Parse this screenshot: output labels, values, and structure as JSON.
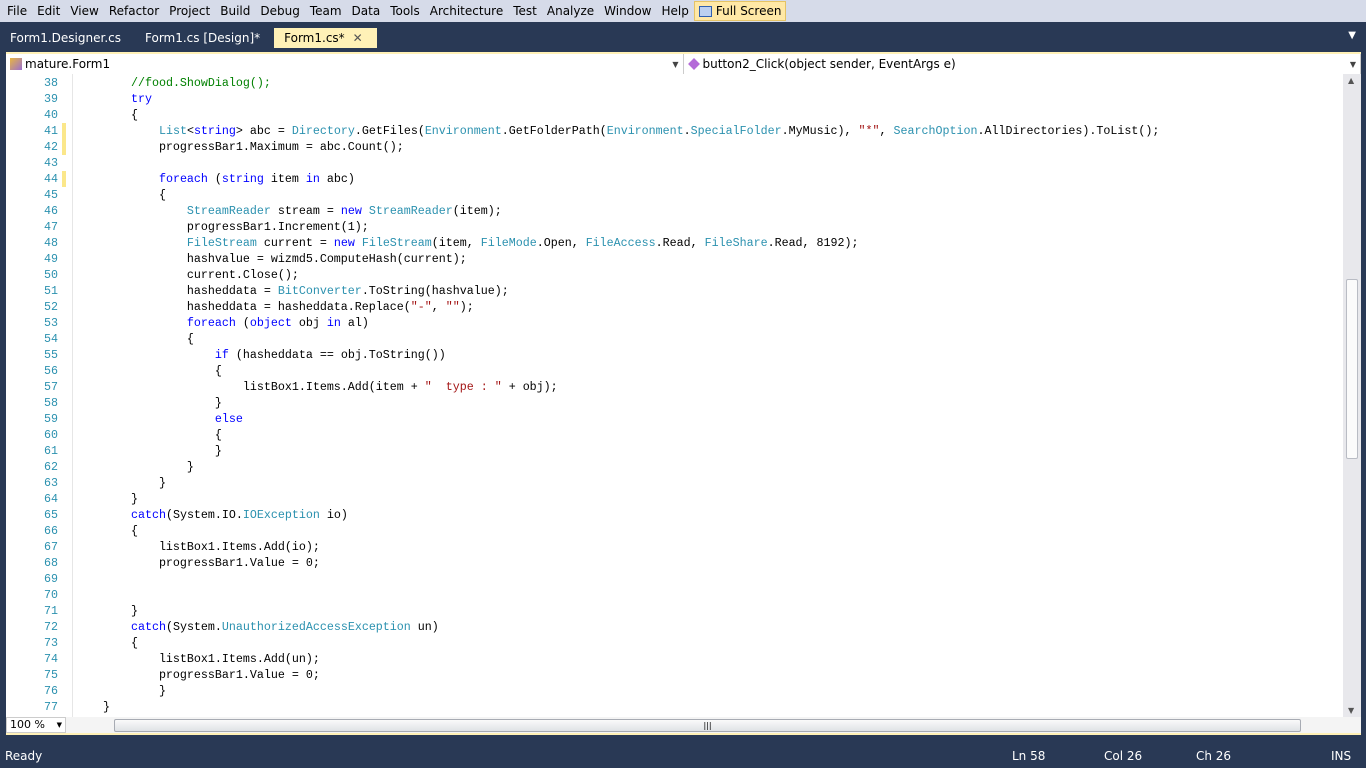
{
  "menu": [
    "File",
    "Edit",
    "View",
    "Refactor",
    "Project",
    "Build",
    "Debug",
    "Team",
    "Data",
    "Tools",
    "Architecture",
    "Test",
    "Analyze",
    "Window",
    "Help"
  ],
  "full_screen": "Full Screen",
  "tabs": [
    {
      "label": "Form1.Designer.cs"
    },
    {
      "label": "Form1.cs [Design]*"
    },
    {
      "label": "Form1.cs*",
      "active": true
    }
  ],
  "nav": {
    "class": "mature.Form1",
    "member": "button2_Click(object sender, EventArgs e)"
  },
  "colors": {
    "keyword": "#0000ff",
    "type": "#2b91af",
    "string": "#a31515",
    "comment": "#008000",
    "chrome": "#293955",
    "active_tab": "#fff1b7"
  },
  "code": [
    {
      "n": 38,
      "t": [
        [
          "p",
          "        "
        ],
        [
          "c",
          "//food.ShowDialog();"
        ]
      ]
    },
    {
      "n": 39,
      "t": [
        [
          "p",
          "        "
        ],
        [
          "k",
          "try"
        ]
      ]
    },
    {
      "n": 40,
      "t": [
        [
          "p",
          "        {"
        ]
      ]
    },
    {
      "n": 41,
      "m": 1,
      "t": [
        [
          "p",
          "            "
        ],
        [
          "t",
          "List"
        ],
        [
          "p",
          "<"
        ],
        [
          "k",
          "string"
        ],
        [
          "p",
          "> abc = "
        ],
        [
          "t",
          "Directory"
        ],
        [
          "p",
          ".GetFiles("
        ],
        [
          "t",
          "Environment"
        ],
        [
          "p",
          ".GetFolderPath("
        ],
        [
          "t",
          "Environment"
        ],
        [
          "p",
          "."
        ],
        [
          "t",
          "SpecialFolder"
        ],
        [
          "p",
          ".MyMusic), "
        ],
        [
          "s",
          "\"*\""
        ],
        [
          "p",
          ", "
        ],
        [
          "t",
          "SearchOption"
        ],
        [
          "p",
          ".AllDirectories).ToList();"
        ]
      ]
    },
    {
      "n": 42,
      "m": 1,
      "t": [
        [
          "p",
          "            progressBar1.Maximum = abc.Count();"
        ]
      ]
    },
    {
      "n": 43,
      "t": []
    },
    {
      "n": 44,
      "m": 1,
      "t": [
        [
          "p",
          "            "
        ],
        [
          "k",
          "foreach"
        ],
        [
          "p",
          " ("
        ],
        [
          "k",
          "string"
        ],
        [
          "p",
          " item "
        ],
        [
          "k",
          "in"
        ],
        [
          "p",
          " abc)"
        ]
      ]
    },
    {
      "n": 45,
      "t": [
        [
          "p",
          "            {"
        ]
      ]
    },
    {
      "n": 46,
      "t": [
        [
          "p",
          "                "
        ],
        [
          "t",
          "StreamReader"
        ],
        [
          "p",
          " stream = "
        ],
        [
          "k",
          "new"
        ],
        [
          "p",
          " "
        ],
        [
          "t",
          "StreamReader"
        ],
        [
          "p",
          "(item);"
        ]
      ]
    },
    {
      "n": 47,
      "t": [
        [
          "p",
          "                progressBar1.Increment(1);"
        ]
      ]
    },
    {
      "n": 48,
      "t": [
        [
          "p",
          "                "
        ],
        [
          "t",
          "FileStream"
        ],
        [
          "p",
          " current = "
        ],
        [
          "k",
          "new"
        ],
        [
          "p",
          " "
        ],
        [
          "t",
          "FileStream"
        ],
        [
          "p",
          "(item, "
        ],
        [
          "t",
          "FileMode"
        ],
        [
          "p",
          ".Open, "
        ],
        [
          "t",
          "FileAccess"
        ],
        [
          "p",
          ".Read, "
        ],
        [
          "t",
          "FileShare"
        ],
        [
          "p",
          ".Read, 8192);"
        ]
      ]
    },
    {
      "n": 49,
      "t": [
        [
          "p",
          "                hashvalue = wizmd5.ComputeHash(current);"
        ]
      ]
    },
    {
      "n": 50,
      "t": [
        [
          "p",
          "                current.Close();"
        ]
      ]
    },
    {
      "n": 51,
      "t": [
        [
          "p",
          "                hasheddata = "
        ],
        [
          "t",
          "BitConverter"
        ],
        [
          "p",
          ".ToString(hashvalue);"
        ]
      ]
    },
    {
      "n": 52,
      "t": [
        [
          "p",
          "                hasheddata = hasheddata.Replace("
        ],
        [
          "s",
          "\"-\""
        ],
        [
          "p",
          ", "
        ],
        [
          "s",
          "\"\""
        ],
        [
          "p",
          ");"
        ]
      ]
    },
    {
      "n": 53,
      "t": [
        [
          "p",
          "                "
        ],
        [
          "k",
          "foreach"
        ],
        [
          "p",
          " ("
        ],
        [
          "k",
          "object"
        ],
        [
          "p",
          " obj "
        ],
        [
          "k",
          "in"
        ],
        [
          "p",
          " al)"
        ]
      ]
    },
    {
      "n": 54,
      "t": [
        [
          "p",
          "                {"
        ]
      ]
    },
    {
      "n": 55,
      "t": [
        [
          "p",
          "                    "
        ],
        [
          "k",
          "if"
        ],
        [
          "p",
          " (hasheddata == obj.ToString())"
        ]
      ]
    },
    {
      "n": 56,
      "t": [
        [
          "p",
          "                    {"
        ]
      ]
    },
    {
      "n": 57,
      "t": [
        [
          "p",
          "                        listBox1.Items.Add(item + "
        ],
        [
          "s",
          "\"  type : \""
        ],
        [
          "p",
          " + obj);"
        ]
      ]
    },
    {
      "n": 58,
      "t": [
        [
          "p",
          "                    }"
        ]
      ]
    },
    {
      "n": 59,
      "t": [
        [
          "p",
          "                    "
        ],
        [
          "k",
          "else"
        ]
      ]
    },
    {
      "n": 60,
      "t": [
        [
          "p",
          "                    {"
        ]
      ]
    },
    {
      "n": 61,
      "t": [
        [
          "p",
          "                    }"
        ]
      ]
    },
    {
      "n": 62,
      "t": [
        [
          "p",
          "                }"
        ]
      ]
    },
    {
      "n": 63,
      "t": [
        [
          "p",
          "            }"
        ]
      ]
    },
    {
      "n": 64,
      "t": [
        [
          "p",
          "        }"
        ]
      ]
    },
    {
      "n": 65,
      "t": [
        [
          "p",
          "        "
        ],
        [
          "k",
          "catch"
        ],
        [
          "p",
          "(System.IO."
        ],
        [
          "t",
          "IOException"
        ],
        [
          "p",
          " io)"
        ]
      ]
    },
    {
      "n": 66,
      "t": [
        [
          "p",
          "        {"
        ]
      ]
    },
    {
      "n": 67,
      "t": [
        [
          "p",
          "            listBox1.Items.Add(io);"
        ]
      ]
    },
    {
      "n": 68,
      "t": [
        [
          "p",
          "            progressBar1.Value = 0;"
        ]
      ]
    },
    {
      "n": 69,
      "t": []
    },
    {
      "n": 70,
      "t": []
    },
    {
      "n": 71,
      "t": [
        [
          "p",
          "        }"
        ]
      ]
    },
    {
      "n": 72,
      "t": [
        [
          "p",
          "        "
        ],
        [
          "k",
          "catch"
        ],
        [
          "p",
          "(System."
        ],
        [
          "t",
          "UnauthorizedAccessException"
        ],
        [
          "p",
          " un)"
        ]
      ]
    },
    {
      "n": 73,
      "t": [
        [
          "p",
          "        {"
        ]
      ]
    },
    {
      "n": 74,
      "t": [
        [
          "p",
          "            listBox1.Items.Add(un);"
        ]
      ]
    },
    {
      "n": 75,
      "t": [
        [
          "p",
          "            progressBar1.Value = 0;"
        ]
      ]
    },
    {
      "n": 76,
      "t": [
        [
          "p",
          "            }"
        ]
      ]
    },
    {
      "n": 77,
      "t": [
        [
          "p",
          "    }"
        ]
      ]
    }
  ],
  "zoom": "100 %",
  "status": {
    "ready": "Ready",
    "ln": "Ln 58",
    "col": "Col 26",
    "ch": "Ch 26",
    "ins": "INS"
  }
}
